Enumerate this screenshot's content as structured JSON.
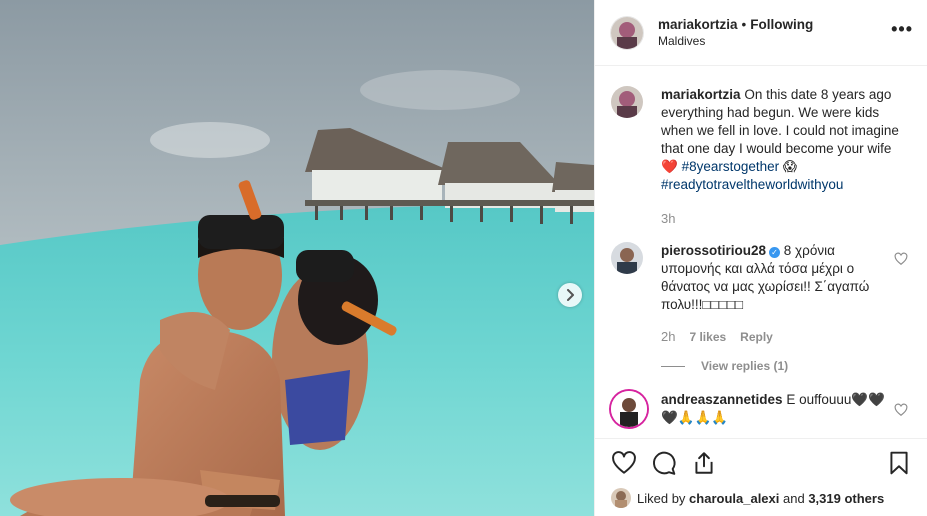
{
  "post": {
    "username": "mariakortzia",
    "follow_status": "Following",
    "location": "Maldives",
    "more_label": "•••"
  },
  "caption": {
    "username": "mariakortzia",
    "text": "On this date 8 years ago everything had begun. We were kids when we fell in love. I could not imagine that one day I would become your wife",
    "emoji_heart": "❤️",
    "hashtag1": "#8yearstogether",
    "emoji_scream": "😱",
    "hashtag2": "#readytotraveltheworldwithyou",
    "time": "3h"
  },
  "comments": [
    {
      "username": "pierossotiriou28",
      "verified": true,
      "text": "8 χρόνια υπομονής και αλλά τόσα μέχρι ο θάνατος να μας χωρίσει!! Σ΄αγαπώ πολυ!!!□□□□□",
      "time": "2h",
      "likes": "7 likes",
      "reply_label": "Reply",
      "view_replies": "View replies (1)"
    },
    {
      "username": "andreaszannetides",
      "text": "Ε ouffouuu🖤🖤🖤🙏🙏🙏"
    }
  ],
  "liked_by": {
    "prefix": "Liked by",
    "user": "charoula_alexi",
    "and": "and",
    "others": "3,319 others"
  },
  "icons": {
    "like": "heart-icon",
    "comment": "comment-icon",
    "share": "share-icon",
    "save": "bookmark-icon",
    "next": "chevron-right-icon"
  }
}
